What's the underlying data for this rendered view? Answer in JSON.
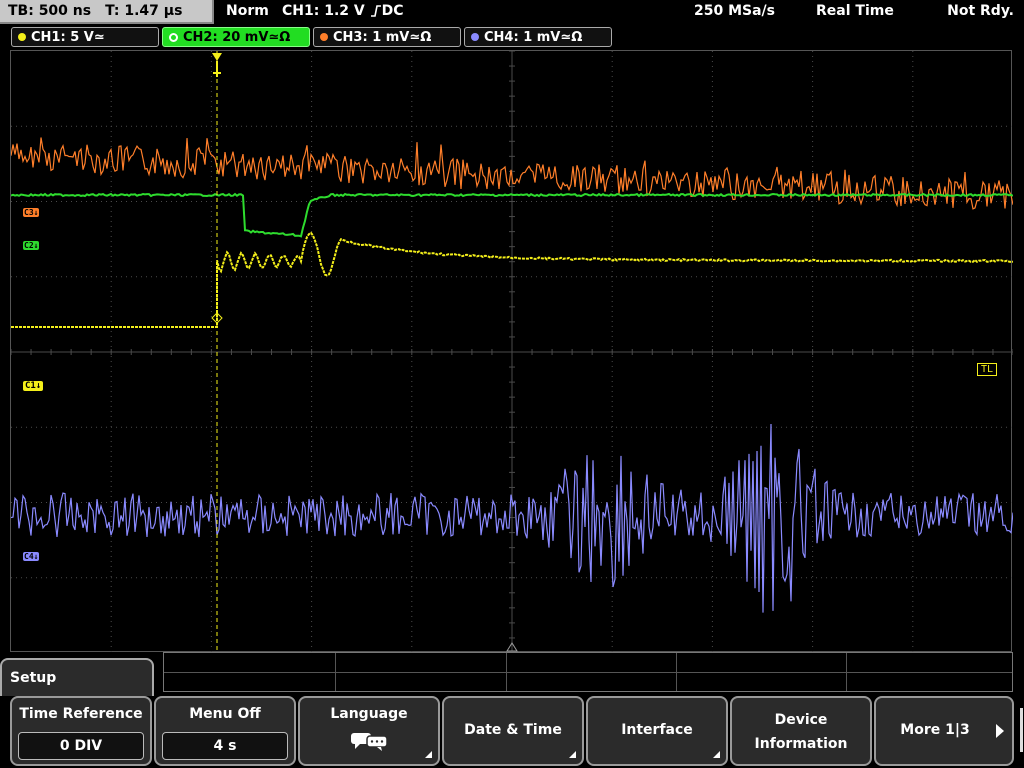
{
  "topbar": {
    "timebase": "TB: 500 ns",
    "trigger_time": "T: 1.47 µs",
    "mode": "Norm",
    "trigger_source": "CH1: 1.2 V",
    "trigger_coupling": "DC",
    "sample_rate": "250 MSa/s",
    "acquisition": "Real Time",
    "status": "Not Rdy."
  },
  "channels": [
    {
      "label": "CH1: 5 V≃",
      "color": "#f4ef1a",
      "active": false
    },
    {
      "label": "CH2: 20 mV≃Ω",
      "color": "#2edc2e",
      "active": true
    },
    {
      "label": "CH3: 1 mV≃Ω",
      "color": "#ff7f2a",
      "active": false
    },
    {
      "label": "CH4: 1 mV≃Ω",
      "color": "#8a8aff",
      "active": false
    }
  ],
  "markers": {
    "ch1": "C1↓",
    "ch2": "C2↓",
    "ch3": "C3↓",
    "ch4": "C4↓",
    "trigger_level": "TL"
  },
  "menu": {
    "title": "Setup",
    "softkeys": [
      {
        "label": "Time Reference",
        "value": "0 DIV"
      },
      {
        "label": "Menu Off",
        "value": "4 s"
      },
      {
        "label": "Language",
        "icon": "speech-bubbles-icon"
      },
      {
        "label": "Date & Time"
      },
      {
        "label": "Interface"
      },
      {
        "label": "Device Information",
        "line1": "Device",
        "line2": "Information"
      },
      {
        "label": "More 1|3"
      }
    ]
  },
  "trace_colors": {
    "ch1": "#f4ef1a",
    "ch2": "#2edc2e",
    "ch3": "#ff7f2a",
    "ch4": "#8a8aff",
    "grid": "#4a4a4a"
  }
}
